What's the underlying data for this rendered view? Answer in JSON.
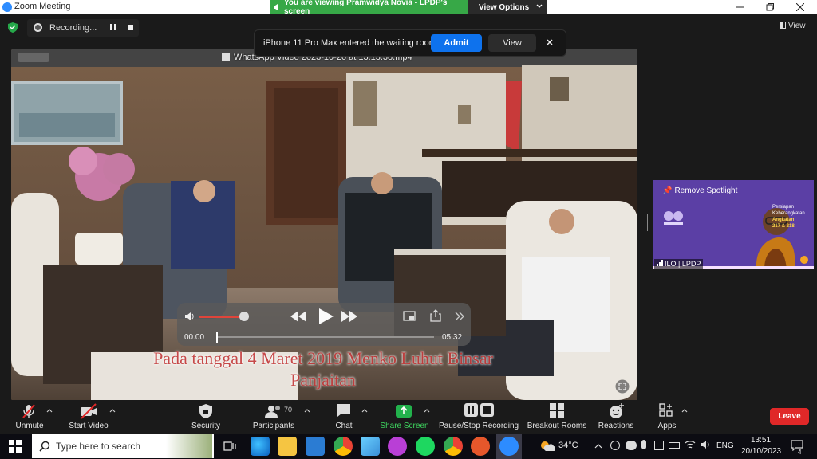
{
  "window": {
    "title": "Zoom Meeting",
    "share_banner": "You are viewing Pramwidya Novia - LPDP's screen",
    "view_options": "View Options"
  },
  "meeting": {
    "recording_label": "Recording...",
    "view_label": "View",
    "waiting_message": "iPhone 11 Pro Max entered the waiting room",
    "admit_label": "Admit",
    "view_popup_label": "View",
    "shared_video": {
      "title": "WhatsApp Video 2023-10-20 at 13.13.38.mp4",
      "caption_line1": "Pada tanggal 4 Maret 2019  Menko Luhut Binsar",
      "caption_line2": "Panjaitan",
      "time_current": "00.00",
      "time_total": "05.32",
      "volume_level": 0.9,
      "playback_progress": 0.0
    },
    "spotlight_tile": {
      "remove_spotlight": "Remove Spotlight",
      "slide_line1": "Persiapan",
      "slide_line2": "Keberangkatan",
      "slide_line3": "Angkatan",
      "slide_line4": "217 & 218",
      "participant_name": "ILO | LPDP"
    }
  },
  "toolbar": {
    "unmute": "Unmute",
    "start_video": "Start Video",
    "security": "Security",
    "participants": "Participants",
    "participant_count": "70",
    "chat": "Chat",
    "share_screen": "Share Screen",
    "pause_stop_recording": "Pause/Stop Recording",
    "breakout_rooms": "Breakout Rooms",
    "reactions": "Reactions",
    "apps": "Apps",
    "leave": "Leave"
  },
  "taskbar": {
    "search_placeholder": "Type here to search",
    "temperature": "34°C",
    "language": "ENG",
    "time": "13:51",
    "date": "20/10/2023",
    "notification_count": "4"
  },
  "colors": {
    "share_green": "#37a847",
    "admit_blue": "#0e72ed",
    "leave_red": "#e02828",
    "spotlight_purple": "#5b3fa5",
    "caption_red": "#c43d3d"
  }
}
